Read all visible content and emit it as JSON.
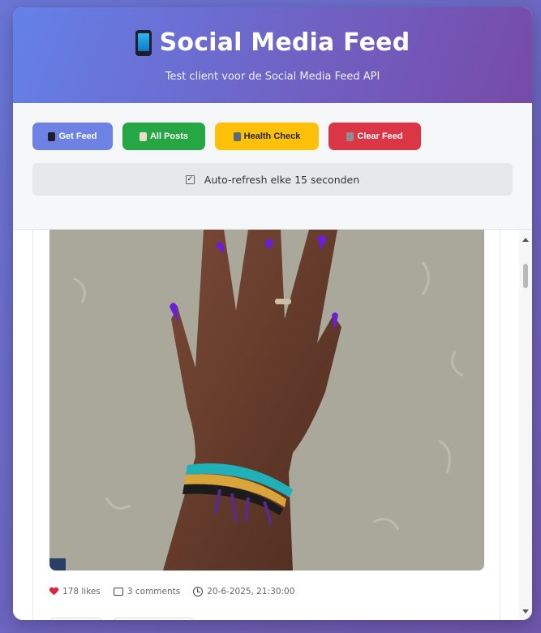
{
  "header": {
    "title": "Social Media Feed",
    "subtitle": "Test client voor de Social Media Feed API"
  },
  "toolbar": {
    "get_feed": "Get Feed",
    "all_posts": "All Posts",
    "health_check": "Health Check",
    "clear_feed": "Clear Feed"
  },
  "auto_refresh": {
    "label": "Auto-refresh elke 15 seconden",
    "checked": true
  },
  "post": {
    "likes": "178 likes",
    "comments": "3 comments",
    "timestamp": "20-6-2025, 21:30:00"
  },
  "icons": {
    "title": "mobile-phone-icon",
    "likes": "heart-icon",
    "comments": "speech-bubble-icon",
    "timestamp": "clock-icon"
  },
  "colors": {
    "get_feed": "#6d82e4",
    "all_posts": "#26a744",
    "health_check": "#ffc107",
    "clear_feed": "#dc3545"
  }
}
